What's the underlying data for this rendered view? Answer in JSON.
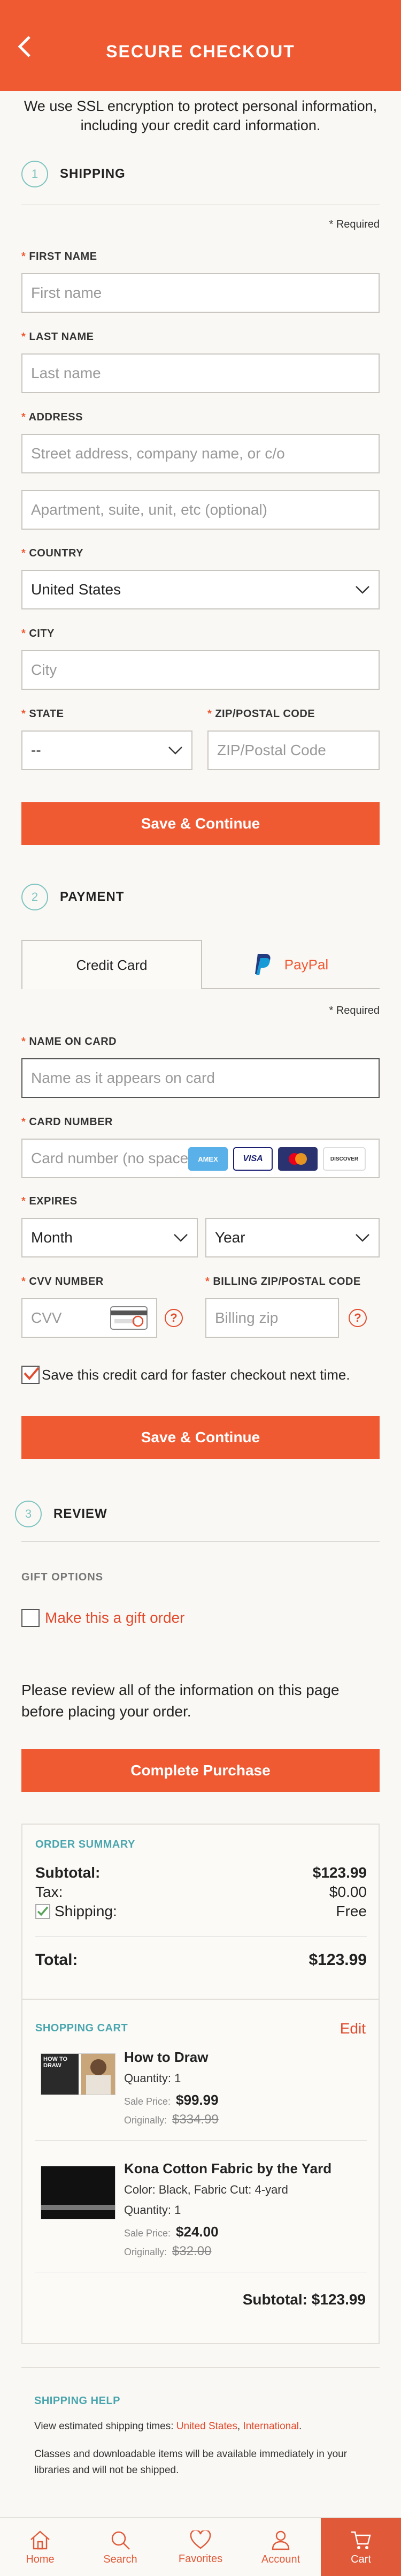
{
  "header": {
    "title": "SECURE CHECKOUT",
    "back_icon": "back-chevron-icon"
  },
  "ssl_note": "We use SSL encryption to protect personal information, including your credit card information.",
  "shipping": {
    "step_number": "1",
    "step_label": "SHIPPING",
    "required_note": "* Required",
    "first_name_label": "FIRST NAME",
    "first_name_placeholder": "First name",
    "last_name_label": "LAST NAME",
    "last_name_placeholder": "Last name",
    "address_label": "ADDRESS",
    "address_placeholder": "Street address, company name, or c/o",
    "address2_placeholder": "Apartment, suite, unit, etc (optional)",
    "country_label": "COUNTRY",
    "country_value": "United States",
    "city_label": "CITY",
    "city_placeholder": "City",
    "state_label": "STATE",
    "state_value": "--",
    "zip_label": "ZIP/POSTAL CODE",
    "zip_placeholder": "ZIP/Postal Code",
    "save_button": "Save & Continue"
  },
  "payment": {
    "step_number": "2",
    "step_label": "PAYMENT",
    "tab_credit": "Credit Card",
    "tab_paypal": "PayPal",
    "required_note": "* Required",
    "name_label": "NAME ON CARD",
    "name_placeholder": "Name as it appears on card",
    "card_label": "CARD NUMBER",
    "card_placeholder": "Card number (no spaces)",
    "card_brands": [
      "AMEX",
      "VISA",
      "MC",
      "DISCOVER"
    ],
    "expires_label": "EXPIRES",
    "month_value": "Month",
    "year_value": "Year",
    "cvv_label": "CVV NUMBER",
    "cvv_placeholder": "CVV",
    "billing_zip_label": "BILLING ZIP/POSTAL CODE",
    "billing_zip_placeholder": "Billing zip",
    "help_glyph": "?",
    "save_card_label": "Save this credit card for faster checkout next time.",
    "save_button": "Save & Continue"
  },
  "review": {
    "step_number": "3",
    "step_label": "REVIEW",
    "gift_options_label": "GIFT OPTIONS",
    "gift_checkbox_label": "Make this a gift order",
    "review_note": "Please review all of the information on this page before placing your order.",
    "complete_button": "Complete Purchase"
  },
  "order_summary": {
    "heading": "ORDER SUMMARY",
    "subtotal_label": "Subtotal:",
    "subtotal_value": "$123.99",
    "tax_label": "Tax:",
    "tax_value": "$0.00",
    "shipping_label": "Shipping:",
    "shipping_value": "Free",
    "total_label": "Total:",
    "total_value": "$123.99"
  },
  "cart": {
    "heading": "SHOPPING CART",
    "edit_label": "Edit",
    "items": [
      {
        "name": "How to Draw",
        "thumb_text": "HOW TO DRAW",
        "detail": "",
        "quantity": "Quantity: 1",
        "sale_label": "Sale Price:",
        "sale_price": "$99.99",
        "orig_label": "Originally:",
        "orig_price": "$334.99"
      },
      {
        "name": "Kona Cotton Fabric by the Yard",
        "thumb_text": "",
        "detail": "Color: Black, Fabric Cut: 4-yard",
        "quantity": "Quantity: 1",
        "sale_label": "Sale Price:",
        "sale_price": "$24.00",
        "orig_label": "Originally:",
        "orig_price": "$32.00"
      }
    ],
    "subtotal": "Subtotal: $123.99"
  },
  "shipping_help": {
    "heading": "SHIPPING HELP",
    "line1_prefix": "View estimated shipping times:",
    "link_us": "United States",
    "comma": ",",
    "link_intl": "International",
    "period": ".",
    "line2": "Classes and downloadable items will be available immediately in your libraries and will not be shipped."
  },
  "nav": {
    "home": "Home",
    "search": "Search",
    "favorites": "Favorites",
    "account": "Account",
    "cart": "Cart"
  },
  "colors": {
    "accent": "#f05a33",
    "teal": "#4aa6ae",
    "background": "#faf8f4"
  }
}
